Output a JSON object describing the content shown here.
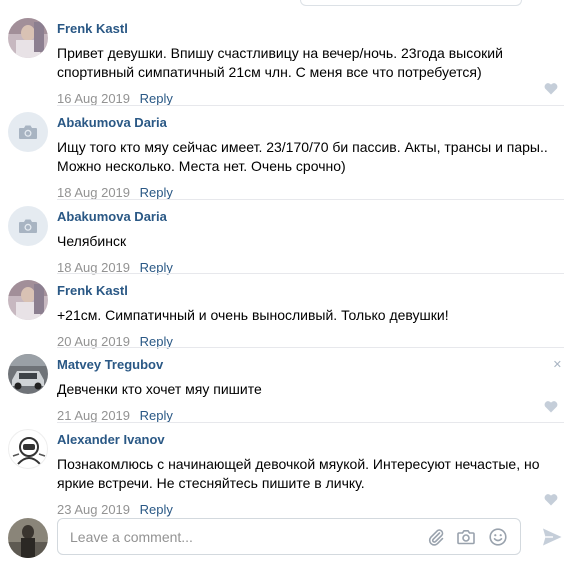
{
  "comments": [
    {
      "author": "Frenk Kastl",
      "text": "Привет девушки. Впишу счастливицу на вечер/ночь. 23года высокий\nспортивный симпатичный 21см члн. С меня все что потребуется)",
      "date": "16 Aug 2019",
      "reply": "Reply",
      "avatar": "photo-avatar"
    },
    {
      "author": "Abakumova Daria",
      "text": "Ищу того кто мяу сейчас имеет. 23/170/70 би пассив. Акты, трансы и пары..\nМожно несколько. Места нет. Очень срочно)",
      "date": "18 Aug 2019",
      "reply": "Reply",
      "avatar": "camera-icon"
    },
    {
      "author": "Abakumova Daria",
      "text": "Челябинск",
      "date": "18 Aug 2019",
      "reply": "Reply",
      "avatar": "camera-icon"
    },
    {
      "author": "Frenk Kastl",
      "text": "+21см. Симпатичный и очень выносливый. Только девушки!",
      "date": "20 Aug 2019",
      "reply": "Reply",
      "avatar": "photo-avatar"
    },
    {
      "author": "Matvey Tregubov",
      "text": "Девченки кто хочет мяу пишите",
      "date": "21 Aug 2019",
      "reply": "Reply",
      "avatar": "car-avatar"
    },
    {
      "author": "Alexander Ivanov",
      "text": "Познакомлюсь с начинающей девочкой мяукой. Интересуют нечастые, но\nяркие встречи. Не стесняйтесь пишите в личку.",
      "date": "23 Aug 2019",
      "reply": "Reply",
      "avatar": "astronaut-avatar"
    }
  ],
  "composer": {
    "placeholder": "Leave a comment...",
    "icons": [
      "paperclip-icon",
      "camera-icon",
      "smiley-icon",
      "send-icon"
    ]
  },
  "colors": {
    "link": "#2a5885",
    "meta": "#939393",
    "divider": "#e7e8ec",
    "icon": "#a8b4c2"
  }
}
